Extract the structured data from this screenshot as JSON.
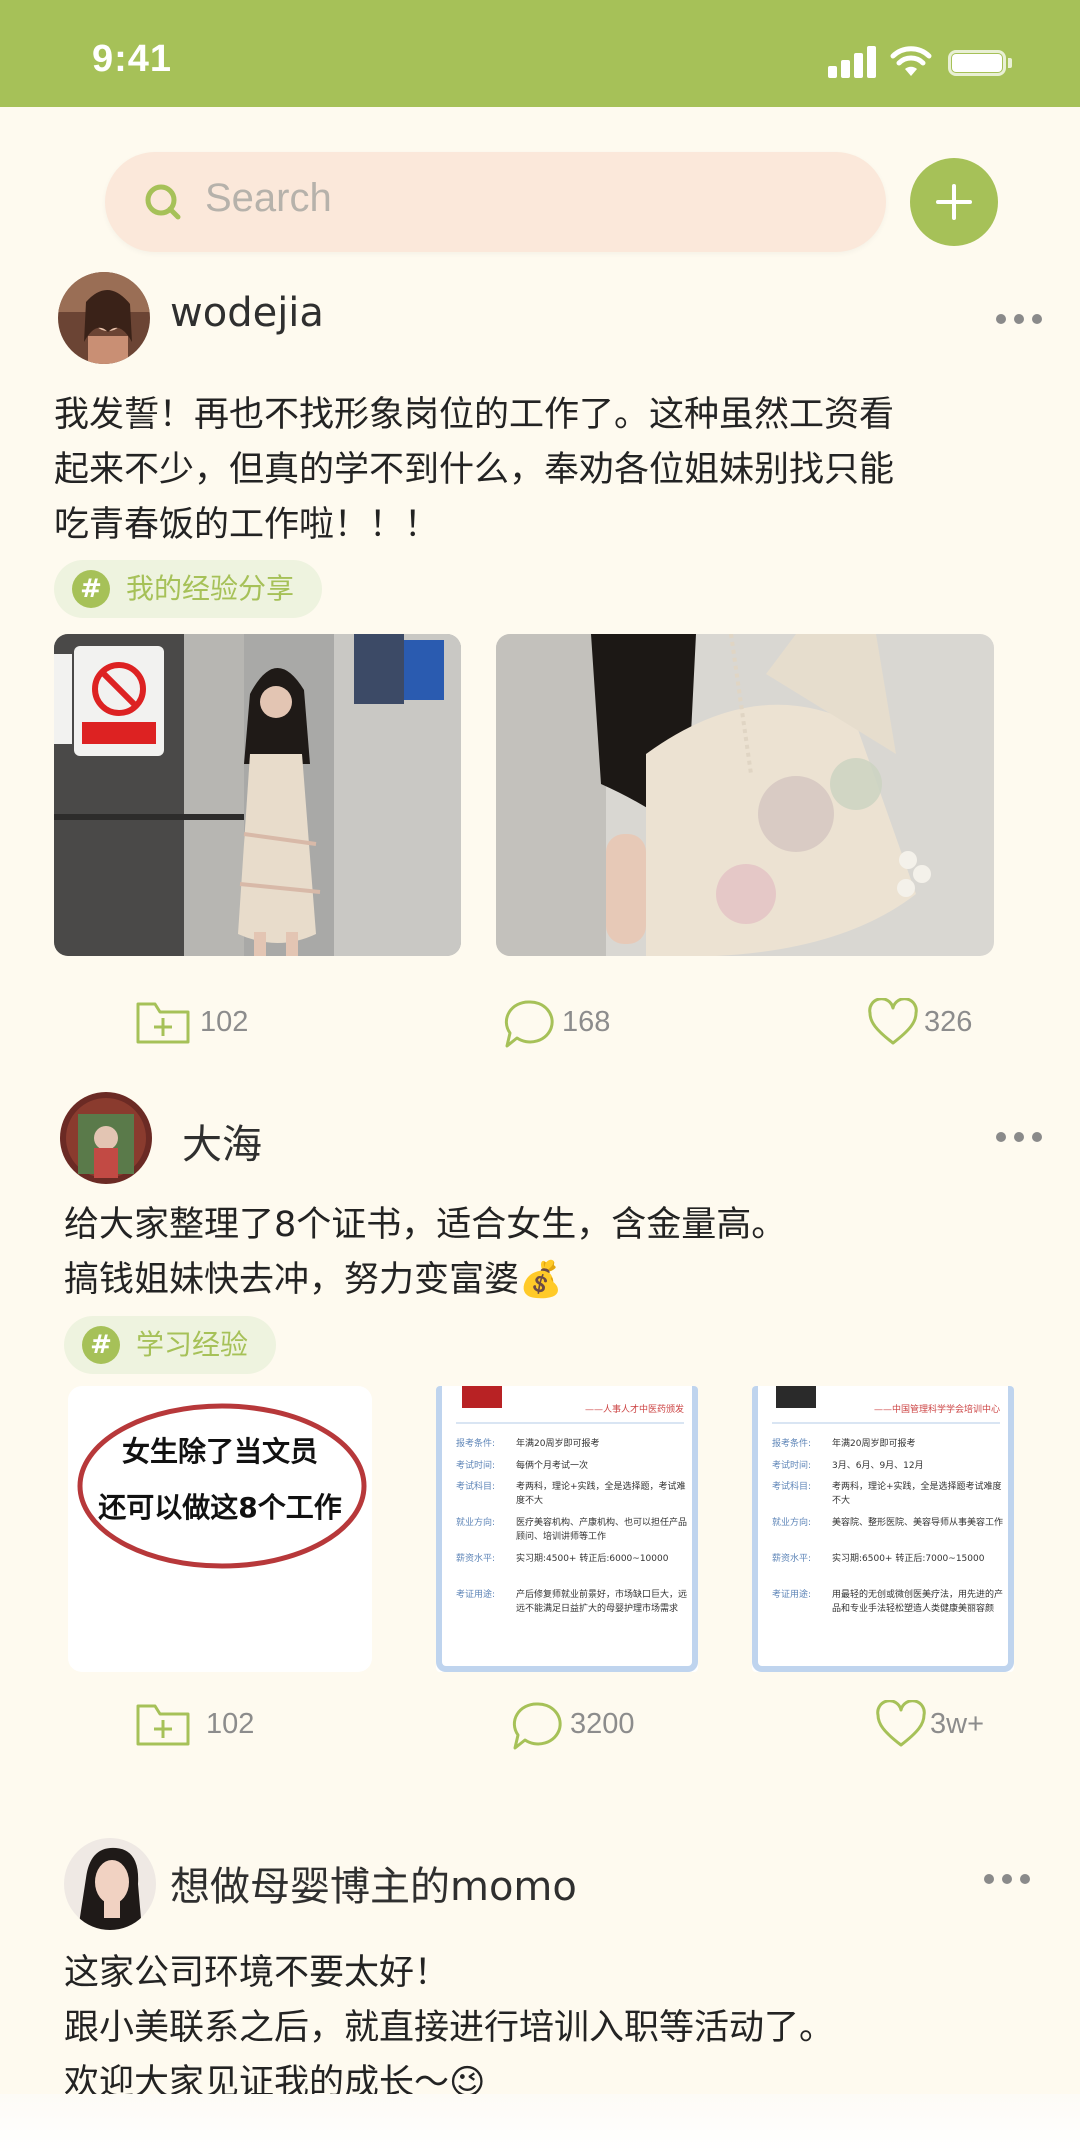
{
  "status_bar": {
    "time": "9:41"
  },
  "search": {
    "placeholder": "Search"
  },
  "posts": [
    {
      "username": "wodejia",
      "text": "我发誓！再也不找形象岗位的工作了。这种虽然工资看\n起来不少，但真的学不到什么，奉劝各位姐妹别找只能\n吃青春饭的工作啦！！！",
      "tag": "我的经验分享",
      "saves": "102",
      "comments": "168",
      "likes": "326"
    },
    {
      "username": "大海",
      "text": "给大家整理了8个证书，适合女生，含金量高。\n搞钱姐妹快去冲，努力变富婆💰",
      "tag": "学习经验",
      "cover_text": [
        "女生除了当文员",
        "还可以做这8个工作"
      ],
      "doc_cards": [
        {
          "header": "——人事人才中医药颁发",
          "rows": [
            {
              "label": "报考条件:",
              "value": "年满20周岁即可报考"
            },
            {
              "label": "考试时间:",
              "value": "每俩个月考试一次"
            },
            {
              "label": "考试科目:",
              "value": "考两科，理论+实践，全是选择题，考试难度不大"
            },
            {
              "label": "就业方向:",
              "value": "医疗美容机构、产康机构、也可以担任产品顾问、培训讲师等工作"
            },
            {
              "label": "薪资水平:",
              "value": "实习期:4500+ 转正后:6000~10000"
            },
            {
              "label": "考证用途:",
              "value": "产后修复师就业前景好，市场缺口巨大，远远不能满足日益扩大的母婴护理市场需求"
            }
          ]
        },
        {
          "header": "——中国管理科学学会培训中心",
          "rows": [
            {
              "label": "报考条件:",
              "value": "年满20周岁即可报考"
            },
            {
              "label": "考试时间:",
              "value": "3月、6月、9月、12月"
            },
            {
              "label": "考试科目:",
              "value": "考两科，理论+实践，全是选择题考试难度不大"
            },
            {
              "label": "就业方向:",
              "value": "美容院、整形医院、美容导师从事美容工作"
            },
            {
              "label": "薪资水平:",
              "value": "实习期:6500+ 转正后:7000~15000"
            },
            {
              "label": "考证用途:",
              "value": "用最轻的无创或微创医美疗法，用先进的产品和专业手法轻松塑造人类健康美丽容颜"
            }
          ]
        }
      ],
      "saves": "102",
      "comments": "3200",
      "likes": "3w+"
    },
    {
      "username": "想做母婴博主的momo",
      "text": "这家公司环境不要太好！\n跟小美联系之后，就直接进行培训入职等活动了。\n欢迎大家见证我的成长～😉"
    }
  ],
  "colors": {
    "accent_green": "#a6c158",
    "search_bg": "#fbe8da",
    "page_bg": "#fefaef",
    "tag_bg": "#eef3df",
    "icon_gray": "#8c8c8c"
  },
  "icons": [
    "signal-icon",
    "wifi-icon",
    "battery-icon",
    "search-icon",
    "plus-icon",
    "more-icon",
    "hashtag-icon",
    "folder-add-icon",
    "comment-icon",
    "heart-icon"
  ]
}
